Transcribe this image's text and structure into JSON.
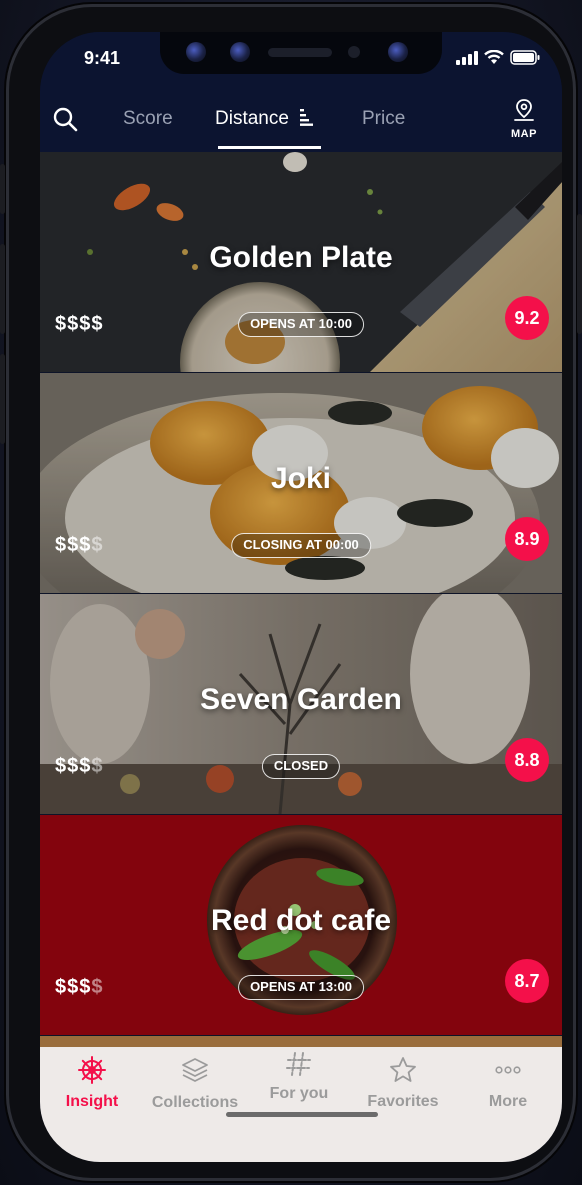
{
  "status_bar": {
    "time": "9:41"
  },
  "nav": {
    "tabs": [
      {
        "label": "Score",
        "active": false
      },
      {
        "label": "Distance",
        "active": true
      },
      {
        "label": "Price",
        "active": false
      }
    ],
    "map_label": "MAP"
  },
  "restaurants": [
    {
      "name": "Golden Plate",
      "price_active": "$$$$",
      "price_dim": "",
      "status": "OPENS AT 10:00",
      "score": "9.2"
    },
    {
      "name": "Joki",
      "price_active": "$$$",
      "price_dim": "$",
      "status": "CLOSING AT 00:00",
      "score": "8.9"
    },
    {
      "name": "Seven Garden",
      "price_active": "$$$",
      "price_dim": "$",
      "status": "CLOSED",
      "score": "8.8"
    },
    {
      "name": "Red dot cafe",
      "price_active": "$$$",
      "price_dim": "$",
      "status": "OPENS AT 13:00",
      "score": "8.7"
    }
  ],
  "tabbar": {
    "items": [
      {
        "label": "Insight",
        "icon": "ship-wheel-icon",
        "active": true
      },
      {
        "label": "Collections",
        "icon": "layers-icon",
        "active": false
      },
      {
        "label": "For you",
        "icon": "hashtag-icon",
        "active": false
      },
      {
        "label": "Favorites",
        "icon": "star-icon",
        "active": false
      },
      {
        "label": "More",
        "icon": "more-dots-icon",
        "active": false
      }
    ]
  },
  "colors": {
    "accent": "#F4104A",
    "nav_bg": "#0C1430"
  }
}
